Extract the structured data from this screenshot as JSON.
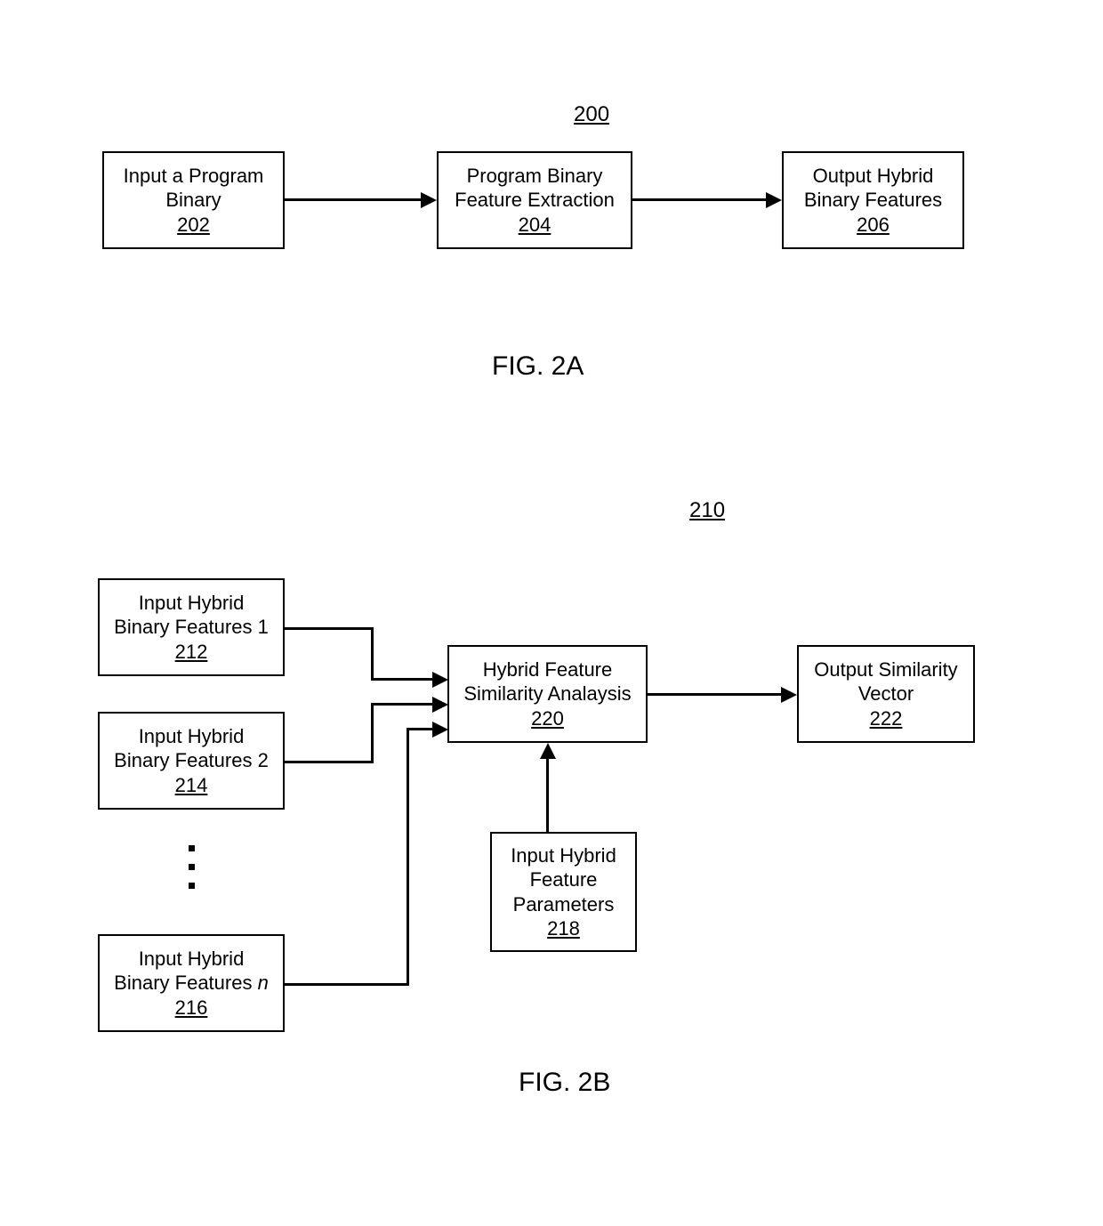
{
  "fig2a": {
    "ref": "200",
    "caption": "FIG. 2A",
    "b202": {
      "l1": "Input a Program",
      "l2": "Binary",
      "ref": "202"
    },
    "b204": {
      "l1": "Program Binary",
      "l2": "Feature Extraction",
      "ref": "204"
    },
    "b206": {
      "l1": "Output Hybrid",
      "l2": "Binary Features",
      "ref": "206"
    }
  },
  "fig2b": {
    "ref": "210",
    "caption": "FIG. 2B",
    "b212": {
      "l1": "Input Hybrid",
      "l2": "Binary Features 1",
      "ref": "212"
    },
    "b214": {
      "l1": "Input Hybrid",
      "l2": "Binary Features 2",
      "ref": "214"
    },
    "b216": {
      "l1": "Input Hybrid",
      "l2_a": "Binary Features ",
      "l2_n": "n",
      "ref": "216"
    },
    "b218": {
      "l1": "Input Hybrid",
      "l2": "Feature",
      "l3": "Parameters",
      "ref": "218"
    },
    "b220": {
      "l1": "Hybrid Feature",
      "l2": "Similarity Analaysis",
      "ref": "220"
    },
    "b222": {
      "l1": "Output Similarity",
      "l2": "Vector",
      "ref": "222"
    }
  }
}
